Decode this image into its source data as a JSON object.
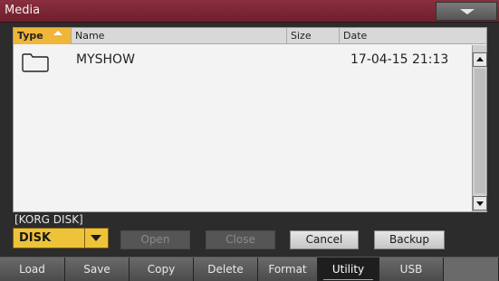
{
  "window": {
    "title": "Media"
  },
  "table": {
    "headers": [
      "Type",
      "Name",
      "Size",
      "Date"
    ],
    "rows": [
      {
        "type_icon": "folder-icon",
        "name": "MYSHOW",
        "size": "",
        "date": "17-04-15 21:13"
      }
    ]
  },
  "device": {
    "label": "[KORG DISK]",
    "selected": "DISK"
  },
  "buttons": {
    "open": "Open",
    "close": "Close",
    "cancel": "Cancel",
    "backup": "Backup"
  },
  "tabs": [
    {
      "label": "Load"
    },
    {
      "label": "Save"
    },
    {
      "label": "Copy"
    },
    {
      "label": "Delete"
    },
    {
      "label": "Format"
    },
    {
      "label": "Utility",
      "active": true
    },
    {
      "label": "USB"
    }
  ]
}
